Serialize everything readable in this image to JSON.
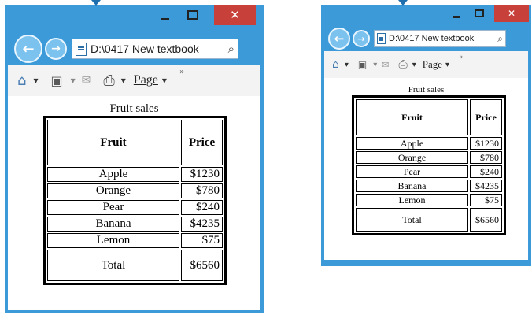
{
  "windows": [
    {
      "address": "D:\\0417 New textbook",
      "page_label": "Page",
      "table_caption": "Fruit sales",
      "headers": [
        "Fruit",
        "Price"
      ],
      "rows": [
        {
          "fruit": "Apple",
          "price": "$1230"
        },
        {
          "fruit": "Orange",
          "price": "$780"
        },
        {
          "fruit": "Pear",
          "price": "$240"
        },
        {
          "fruit": "Banana",
          "price": "$4235"
        },
        {
          "fruit": "Lemon",
          "price": "$75"
        }
      ],
      "total": {
        "fruit": "Total",
        "price": "$6560"
      }
    },
    {
      "address": "D:\\0417 New textbook",
      "page_label": "Page",
      "table_caption": "Fruit sales",
      "headers": [
        "Fruit",
        "Price"
      ],
      "rows": [
        {
          "fruit": "Apple",
          "price": "$1230"
        },
        {
          "fruit": "Orange",
          "price": "$780"
        },
        {
          "fruit": "Pear",
          "price": "$240"
        },
        {
          "fruit": "Banana",
          "price": "$4235"
        },
        {
          "fruit": "Lemon",
          "price": "$75"
        }
      ],
      "total": {
        "fruit": "Total",
        "price": "$6560"
      }
    }
  ],
  "glyphs": {
    "close": "✕",
    "back": "←",
    "forward": "→",
    "search": "⌕",
    "home": "⌂",
    "feed": "▣",
    "mail": "✉",
    "print": "⎙",
    "dropdown": "▾",
    "more": "»"
  },
  "colors": {
    "window_frame": "#3d9ad8",
    "close_button": "#c7413a",
    "nav_button": "#7cc2ee",
    "command_bar": "#f3f3f3"
  }
}
